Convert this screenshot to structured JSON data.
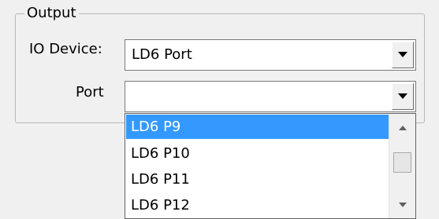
{
  "output_group": {
    "title": "Output"
  },
  "io_device": {
    "label": "IO Device:",
    "value": "LD6 Port"
  },
  "port": {
    "label": "Port",
    "value": ""
  },
  "dropdown": {
    "items": [
      "LD6 P9",
      "LD6 P10",
      "LD6 P11",
      "LD6 P12"
    ],
    "selected_index": 0
  },
  "icons": {
    "combo_arrow": "chevron-down-icon",
    "scroll_up": "scroll-up-arrow-icon",
    "scroll_down": "scroll-down-arrow-icon"
  },
  "colors": {
    "selection": "#3399ff",
    "background": "#f0f0f0"
  }
}
